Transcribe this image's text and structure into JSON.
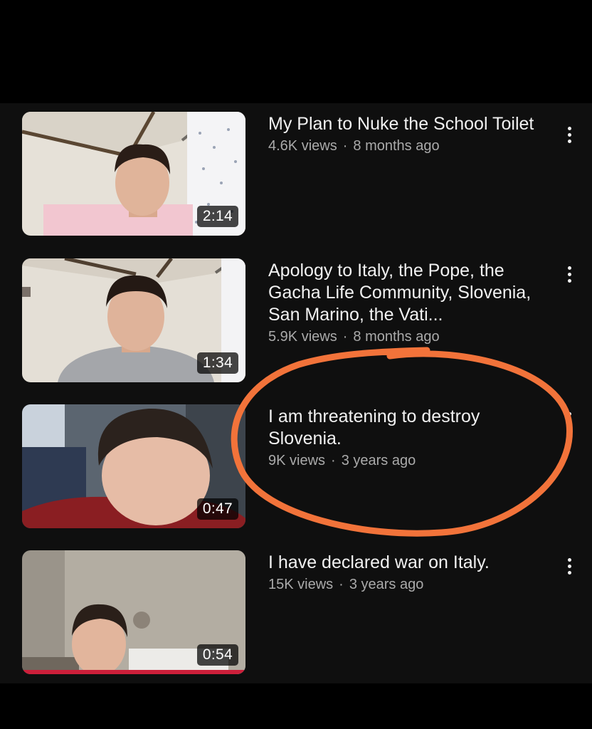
{
  "videos": [
    {
      "title": "My Plan to Nuke the School Toilet",
      "views": "4.6K views",
      "age": "8 months ago",
      "duration": "2:14",
      "menu_icon": "more-vert-icon"
    },
    {
      "title": "Apology to Italy, the Pope, the Gacha Life Community, Slovenia,  San Marino, the Vati...",
      "views": "5.9K views",
      "age": "8 months ago",
      "duration": "1:34",
      "menu_icon": "more-vert-icon"
    },
    {
      "title": "I am threatening to destroy Slovenia.",
      "views": "9K views",
      "age": "3 years ago",
      "duration": "0:47",
      "menu_icon": "more-vert-icon"
    },
    {
      "title": "I have declared war on Italy.",
      "views": "15K views",
      "age": "3 years ago",
      "duration": "0:54",
      "watch_progress": 1.0,
      "menu_icon": "more-vert-icon"
    }
  ],
  "colors": {
    "background": "#0f0f0f",
    "title": "#f1f1f1",
    "meta": "#aaaaaa",
    "annotation_circle": "#f2733a",
    "progress": "#cc1f3a"
  }
}
